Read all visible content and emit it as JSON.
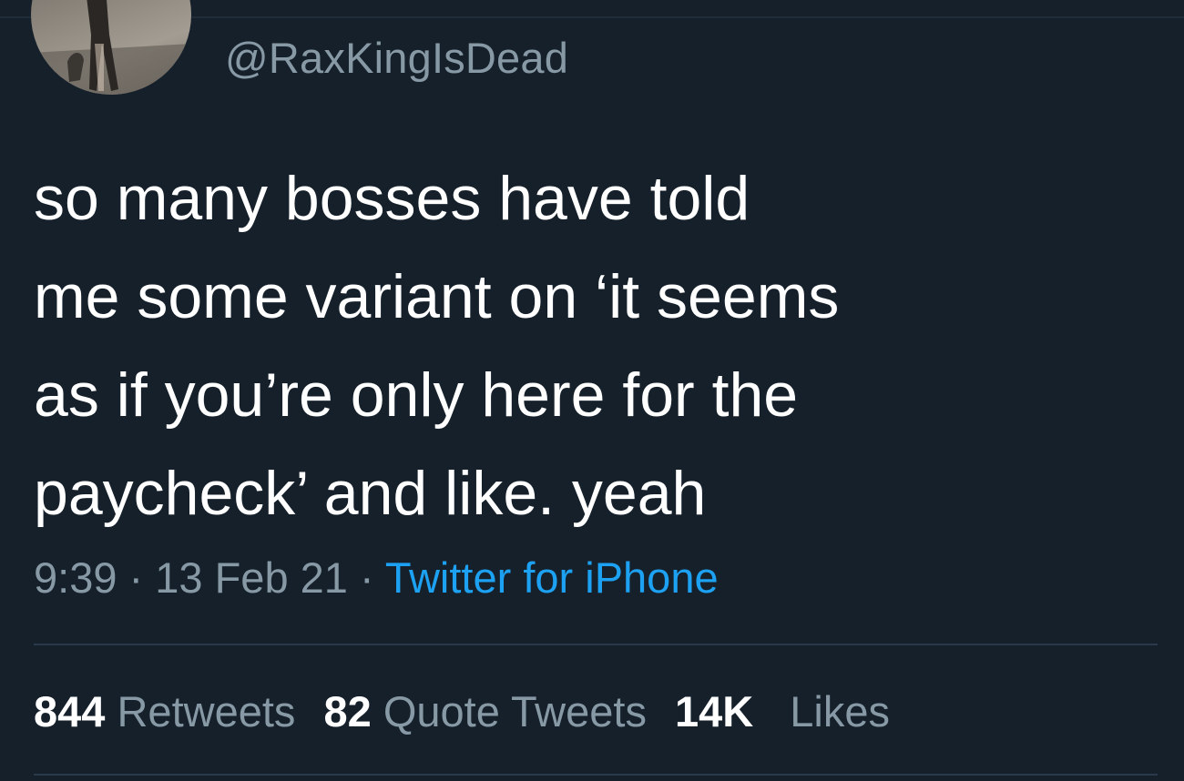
{
  "tweet": {
    "handle": "@RaxKingIsDead",
    "text": "so many bosses have told\nme some variant on ‘it seems\nas if you’re only here for the\npaycheck’ and like. yeah",
    "time": "9:39",
    "separator": "·",
    "date": "13 Feb 21",
    "source": "Twitter for iPhone"
  },
  "stats": {
    "retweets_count": "844",
    "retweets_label": "Retweets",
    "quotes_count": "82",
    "quotes_label": "Quote Tweets",
    "likes_count": "14K",
    "likes_label": "Likes"
  },
  "colors": {
    "background": "#15202b",
    "text": "#ffffff",
    "muted": "#8899a6",
    "accent": "#1da1f2"
  }
}
